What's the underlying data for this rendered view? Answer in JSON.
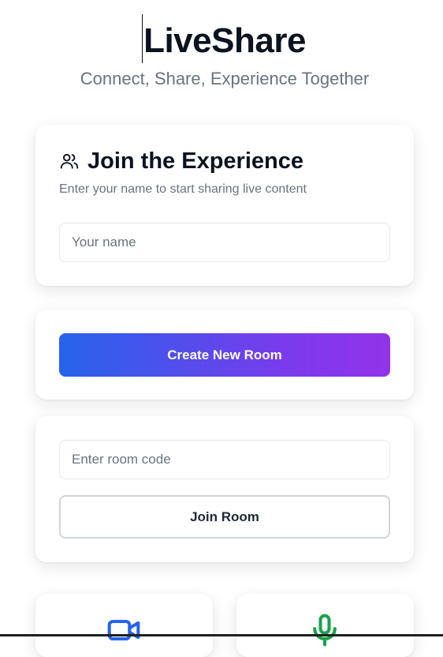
{
  "header": {
    "title": "LiveShare",
    "subtitle": "Connect, Share, Experience Together"
  },
  "join_card": {
    "icon": "users-icon",
    "title": "Join the Experience",
    "description": "Enter your name to start sharing live content",
    "name_input": {
      "value": "",
      "placeholder": "Your name"
    }
  },
  "create_card": {
    "create_button_label": "Create New Room"
  },
  "room_card": {
    "code_input": {
      "value": "",
      "placeholder": "Enter room code"
    },
    "join_button_label": "Join Room"
  },
  "features": {
    "left_icon": "video-camera-icon",
    "right_icon": "microphone-icon"
  },
  "colors": {
    "gradient_start": "#2563eb",
    "gradient_end": "#9333ea",
    "video_icon": "#2563eb",
    "mic_icon": "#16a34a"
  }
}
